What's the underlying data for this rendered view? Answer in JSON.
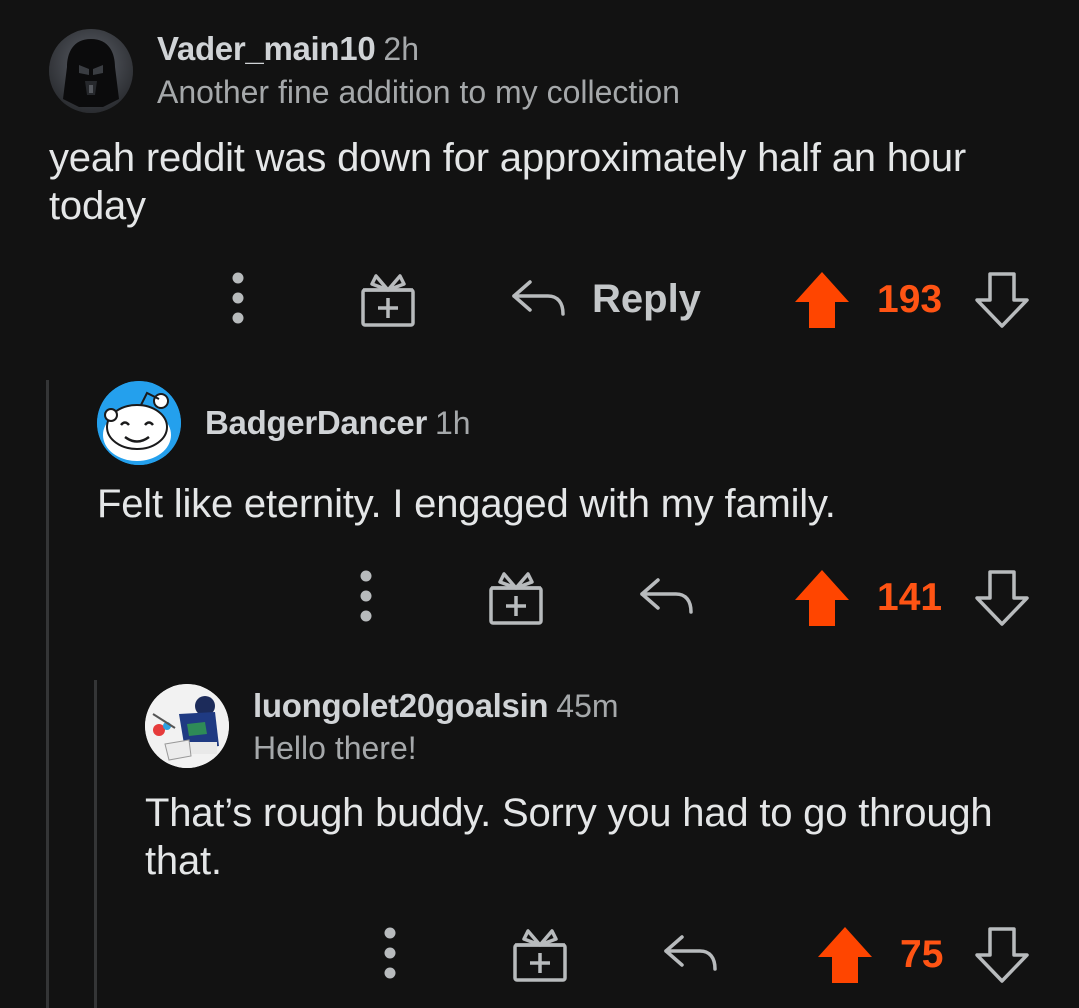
{
  "comments": [
    {
      "username": "Vader_main10",
      "time": "2h",
      "flair": "Another fine addition to my collection",
      "body": "yeah reddit was down for approximately half an hour today",
      "score": "193",
      "reply_label": "Reply",
      "avatar_icon": "darth-vader-avatar"
    },
    {
      "username": "BadgerDancer",
      "time": "1h",
      "flair": "",
      "body": "Felt like eternity. I engaged with my family.",
      "score": "141",
      "avatar_icon": "snoo-avatar"
    },
    {
      "username": "luongolet20goalsin",
      "time": "45m",
      "flair": "Hello there!",
      "body": "That’s rough buddy. Sorry you had to go through that.",
      "score": "75",
      "avatar_icon": "hockey-goalie-avatar"
    }
  ],
  "colors": {
    "background": "#121212",
    "upvote_active": "#ff4500",
    "score_active": "#ff5414",
    "icon_gray": "#b8bbbd",
    "thread_line": "#343536"
  },
  "icons": [
    "more-options-icon",
    "award-icon",
    "reply-icon",
    "upvote-icon",
    "downvote-icon"
  ]
}
